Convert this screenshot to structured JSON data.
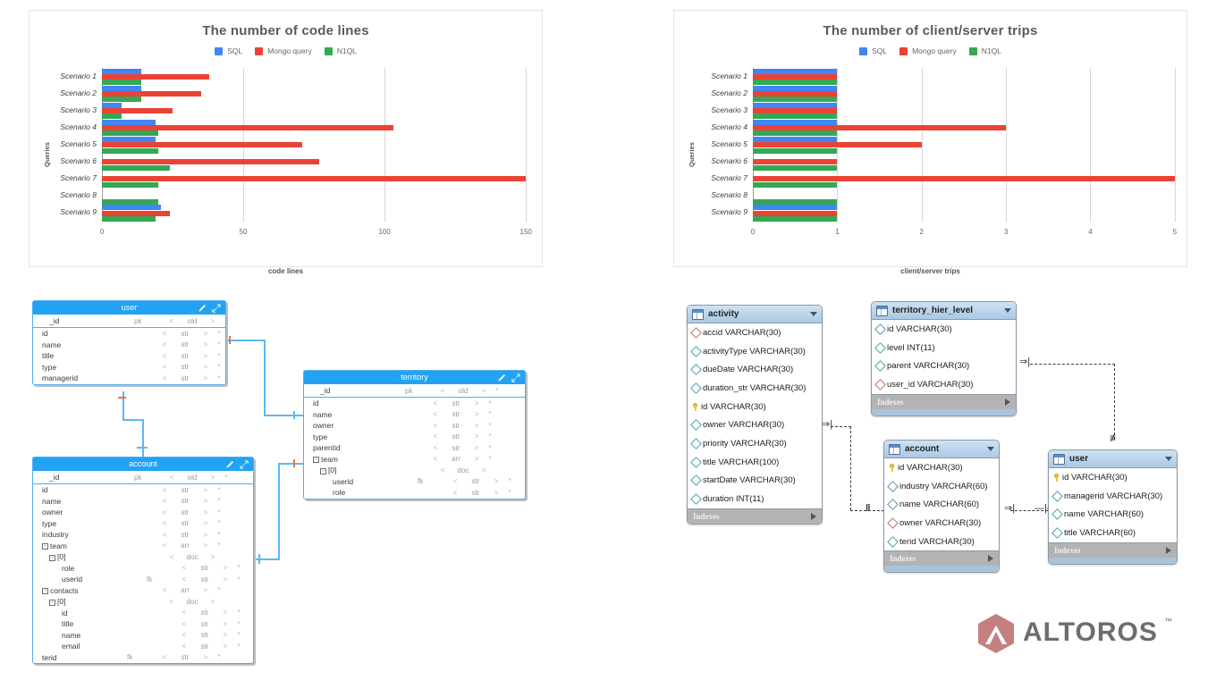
{
  "charts": [
    {
      "title": "The number of code lines",
      "xlabel": "code lines",
      "ylabel": "Queries",
      "legend": [
        {
          "label": "SQL",
          "color": "#4285f4"
        },
        {
          "label": "Mongo query",
          "color": "#ea4335"
        },
        {
          "label": "N1QL",
          "color": "#34a853"
        }
      ],
      "ticks": [
        "0",
        "50",
        "100",
        "150"
      ]
    },
    {
      "title": "The number of client/server trips",
      "xlabel": "client/server trips",
      "ylabel": "Queries",
      "legend": [
        {
          "label": "SQL",
          "color": "#4285f4"
        },
        {
          "label": "Mongo query",
          "color": "#ea4335"
        },
        {
          "label": "N1QL",
          "color": "#34a853"
        }
      ],
      "ticks": [
        "0",
        "1",
        "2",
        "3",
        "4",
        "5"
      ]
    }
  ],
  "chart_data": [
    {
      "type": "bar",
      "orientation": "horizontal",
      "title": "The number of code lines",
      "xlabel": "code lines",
      "ylabel": "Queries",
      "categories": [
        "Scenario 1",
        "Scenario 2",
        "Scenario 3",
        "Scenario 4",
        "Scenario 5",
        "Scenario 6",
        "Scenario 7",
        "Scenario 8",
        "Scenario 9"
      ],
      "series": [
        {
          "name": "SQL",
          "color": "#4285f4",
          "values": [
            14,
            14,
            7,
            19,
            19,
            0,
            0,
            0,
            21
          ]
        },
        {
          "name": "Mongo query",
          "color": "#ea4335",
          "values": [
            38,
            35,
            25,
            103,
            71,
            77,
            150,
            0,
            24
          ]
        },
        {
          "name": "N1QL",
          "color": "#34a853",
          "values": [
            14,
            14,
            7,
            20,
            20,
            24,
            20,
            20,
            19
          ]
        }
      ],
      "xlim": [
        0,
        155
      ],
      "xticks": [
        0,
        50,
        100,
        150
      ],
      "grid": true,
      "legend_position": "top"
    },
    {
      "type": "bar",
      "orientation": "horizontal",
      "title": "The number of client/server trips",
      "xlabel": "client/server trips",
      "ylabel": "Queries",
      "categories": [
        "Scenario 1",
        "Scenario 2",
        "Scenario 3",
        "Scenario 4",
        "Scenario 5",
        "Scenario 6",
        "Scenario 7",
        "Scenario 8",
        "Scenario 9"
      ],
      "series": [
        {
          "name": "SQL",
          "color": "#4285f4",
          "values": [
            1,
            1,
            1,
            1,
            1,
            0,
            0,
            0,
            1
          ]
        },
        {
          "name": "Mongo query",
          "color": "#ea4335",
          "values": [
            1,
            1,
            1,
            3,
            2,
            1,
            5,
            0,
            1
          ]
        },
        {
          "name": "N1QL",
          "color": "#34a853",
          "values": [
            1,
            1,
            1,
            1,
            1,
            1,
            1,
            1,
            1
          ]
        }
      ],
      "xlim": [
        0,
        5.15
      ],
      "xticks": [
        0,
        1,
        2,
        3,
        4,
        5
      ],
      "grid": true,
      "legend_position": "top"
    }
  ],
  "mongo_diagram": {
    "tables": [
      {
        "name": "user",
        "columns": [
          {
            "name": "_id",
            "key": "pk",
            "lt": "<",
            "type": "old",
            "gt": ">",
            "star": "*",
            "indent": 0
          },
          {
            "name": "id",
            "key": "",
            "lt": "<",
            "type": "str",
            "gt": ">",
            "star": "*",
            "indent": 0
          },
          {
            "name": "name",
            "key": "",
            "lt": "<",
            "type": "str",
            "gt": ">",
            "star": "*",
            "indent": 0
          },
          {
            "name": "title",
            "key": "",
            "lt": "<",
            "type": "str",
            "gt": ">",
            "star": "*",
            "indent": 0
          },
          {
            "name": "type",
            "key": "",
            "lt": "<",
            "type": "str",
            "gt": ">",
            "star": "*",
            "indent": 0
          },
          {
            "name": "managerid",
            "key": "",
            "lt": "<",
            "type": "str",
            "gt": ">",
            "star": "*",
            "indent": 0
          }
        ]
      },
      {
        "name": "account",
        "columns": [
          {
            "name": "_id",
            "key": "pk",
            "lt": "<",
            "type": "old",
            "gt": ">",
            "star": "*",
            "indent": 0
          },
          {
            "name": "id",
            "key": "",
            "lt": "<",
            "type": "str",
            "gt": ">",
            "star": "*",
            "indent": 0
          },
          {
            "name": "name",
            "key": "",
            "lt": "<",
            "type": "str",
            "gt": ">",
            "star": "*",
            "indent": 0
          },
          {
            "name": "owner",
            "key": "",
            "lt": "<",
            "type": "str",
            "gt": ">",
            "star": "*",
            "indent": 0
          },
          {
            "name": "type",
            "key": "",
            "lt": "<",
            "type": "str",
            "gt": ">",
            "star": "*",
            "indent": 0
          },
          {
            "name": "industry",
            "key": "",
            "lt": "<",
            "type": "str",
            "gt": ">",
            "star": "*",
            "indent": 0
          },
          {
            "name": "team",
            "key": "",
            "lt": "<",
            "type": "arr",
            "gt": ">",
            "star": "*",
            "indent": 0,
            "expander": "-"
          },
          {
            "name": "[0]",
            "key": "",
            "lt": "<",
            "type": "doc",
            "gt": ">",
            "star": "",
            "indent": 1,
            "expander": "-"
          },
          {
            "name": "role",
            "key": "",
            "lt": "<",
            "type": "str",
            "gt": ">",
            "star": "*",
            "indent": 2
          },
          {
            "name": "userid",
            "key": "fk",
            "lt": "<",
            "type": "str",
            "gt": ">",
            "star": "*",
            "indent": 2
          },
          {
            "name": "contacts",
            "key": "",
            "lt": "<",
            "type": "arr",
            "gt": ">",
            "star": "*",
            "indent": 0,
            "expander": "-"
          },
          {
            "name": "[0]",
            "key": "",
            "lt": "<",
            "type": "doc",
            "gt": ">",
            "star": "",
            "indent": 1,
            "expander": "-"
          },
          {
            "name": "id",
            "key": "",
            "lt": "<",
            "type": "str",
            "gt": ">",
            "star": "*",
            "indent": 2
          },
          {
            "name": "title",
            "key": "",
            "lt": "<",
            "type": "str",
            "gt": ">",
            "star": "*",
            "indent": 2
          },
          {
            "name": "name",
            "key": "",
            "lt": "<",
            "type": "str",
            "gt": ">",
            "star": "*",
            "indent": 2
          },
          {
            "name": "email",
            "key": "",
            "lt": "<",
            "type": "str",
            "gt": ">",
            "star": "*",
            "indent": 2
          },
          {
            "name": "terid",
            "key": "fk",
            "lt": "<",
            "type": "str",
            "gt": ">",
            "star": "*",
            "indent": 0
          }
        ]
      },
      {
        "name": "territory",
        "columns": [
          {
            "name": "_id",
            "key": "pk",
            "lt": "<",
            "type": "old",
            "gt": ">",
            "star": "*",
            "indent": 0
          },
          {
            "name": "id",
            "key": "",
            "lt": "<",
            "type": "str",
            "gt": ">",
            "star": "*",
            "indent": 0
          },
          {
            "name": "name",
            "key": "",
            "lt": "<",
            "type": "str",
            "gt": ">",
            "star": "*",
            "indent": 0
          },
          {
            "name": "owner",
            "key": "",
            "lt": "<",
            "type": "str",
            "gt": ">",
            "star": "*",
            "indent": 0
          },
          {
            "name": "type",
            "key": "",
            "lt": "<",
            "type": "str",
            "gt": ">",
            "star": "*",
            "indent": 0
          },
          {
            "name": "parentid",
            "key": "",
            "lt": "<",
            "type": "str",
            "gt": ">",
            "star": "*",
            "indent": 0
          },
          {
            "name": "team",
            "key": "",
            "lt": "<",
            "type": "arr",
            "gt": ">",
            "star": "*",
            "indent": 0,
            "expander": "-"
          },
          {
            "name": "[0]",
            "key": "",
            "lt": "<",
            "type": "doc",
            "gt": ">",
            "star": "",
            "indent": 1,
            "expander": "-"
          },
          {
            "name": "userid",
            "key": "fk",
            "lt": "<",
            "type": "str",
            "gt": ">",
            "star": "*",
            "indent": 2
          },
          {
            "name": "role",
            "key": "",
            "lt": "<",
            "type": "str",
            "gt": ">",
            "star": "*",
            "indent": 2
          }
        ]
      }
    ]
  },
  "sql_diagram": {
    "indexes_label": "Indexes",
    "tables": [
      {
        "name": "activity",
        "columns": [
          {
            "name": "accid VARCHAR(30)",
            "key": "fk"
          },
          {
            "name": "activityType VARCHAR(30)",
            "key": "col"
          },
          {
            "name": "dueDate VARCHAR(30)",
            "key": "col"
          },
          {
            "name": "duration_str VARCHAR(30)",
            "key": "col"
          },
          {
            "name": "id VARCHAR(30)",
            "key": "pk"
          },
          {
            "name": "owner VARCHAR(30)",
            "key": "col"
          },
          {
            "name": "priority VARCHAR(30)",
            "key": "col"
          },
          {
            "name": "title VARCHAR(100)",
            "key": "col"
          },
          {
            "name": "startDate VARCHAR(30)",
            "key": "col"
          },
          {
            "name": "duration INT(11)",
            "key": "col"
          }
        ]
      },
      {
        "name": "territory_hier_level",
        "columns": [
          {
            "name": "id VARCHAR(30)",
            "key": "col"
          },
          {
            "name": "level INT(11)",
            "key": "col"
          },
          {
            "name": "parent VARCHAR(30)",
            "key": "col"
          },
          {
            "name": "user_id VARCHAR(30)",
            "key": "fk"
          }
        ]
      },
      {
        "name": "account",
        "columns": [
          {
            "name": "id VARCHAR(30)",
            "key": "pk"
          },
          {
            "name": "industry VARCHAR(60)",
            "key": "col"
          },
          {
            "name": "name VARCHAR(60)",
            "key": "col"
          },
          {
            "name": "owner VARCHAR(30)",
            "key": "fk"
          },
          {
            "name": "terid VARCHAR(30)",
            "key": "col"
          }
        ]
      },
      {
        "name": "user",
        "columns": [
          {
            "name": "id VARCHAR(30)",
            "key": "pk"
          },
          {
            "name": "managerid VARCHAR(30)",
            "key": "col"
          },
          {
            "name": "name VARCHAR(60)",
            "key": "col"
          },
          {
            "name": "title VARCHAR(60)",
            "key": "col"
          }
        ]
      }
    ]
  },
  "logo": {
    "text": "ALTOROS",
    "tm": "™",
    "mark_color": "#c48080",
    "text_color": "#6d6d6d"
  }
}
